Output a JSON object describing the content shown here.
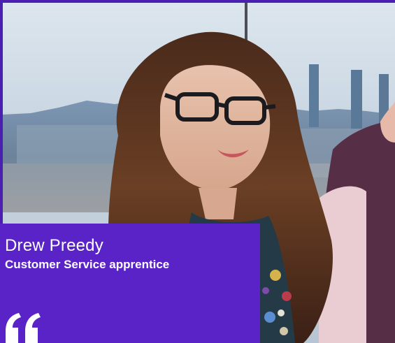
{
  "profile": {
    "name": "Drew Preedy",
    "role": "Customer Service apprentice"
  },
  "icons": {
    "quote": "opening-quote-icon"
  },
  "colors": {
    "accent": "#5a23c8",
    "border": "#4b1fb0",
    "text": "#ffffff"
  }
}
